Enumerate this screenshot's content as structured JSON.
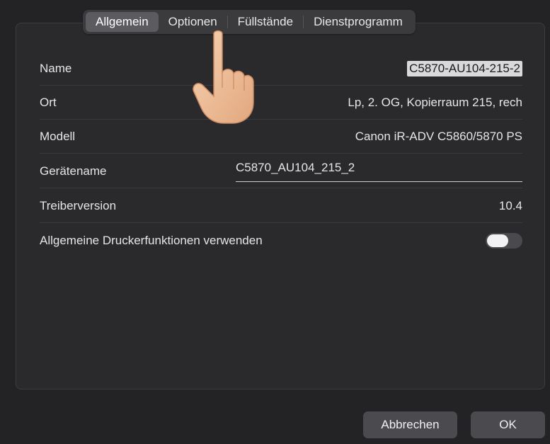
{
  "tabs": [
    {
      "label": "Allgemein",
      "selected": true
    },
    {
      "label": "Optionen",
      "selected": false
    },
    {
      "label": "Füllstände",
      "selected": false
    },
    {
      "label": "Dienstprogramm",
      "selected": false
    }
  ],
  "fields": {
    "name": {
      "label": "Name",
      "value": "C5870-AU104-215-2"
    },
    "location": {
      "label": "Ort",
      "value": "Lp, 2. OG, Kopierraum 215, rech"
    },
    "model": {
      "label": "Modell",
      "value": "Canon iR-ADV C5860/5870 PS"
    },
    "device_name": {
      "label": "Gerätename",
      "value": "C5870_AU104_215_2"
    },
    "driver_version": {
      "label": "Treiberversion",
      "value": "10.4"
    },
    "shared_features": {
      "label": "Allgemeine Druckerfunktionen verwenden",
      "enabled": false
    }
  },
  "buttons": {
    "cancel": "Abbrechen",
    "ok": "OK"
  },
  "icons": {
    "pointer": "pointing-hand-icon"
  },
  "colors": {
    "background": "#232325",
    "panel": "#2a2a2c",
    "selected_tab": "#5c5c60",
    "button": "#4b4b4f"
  }
}
